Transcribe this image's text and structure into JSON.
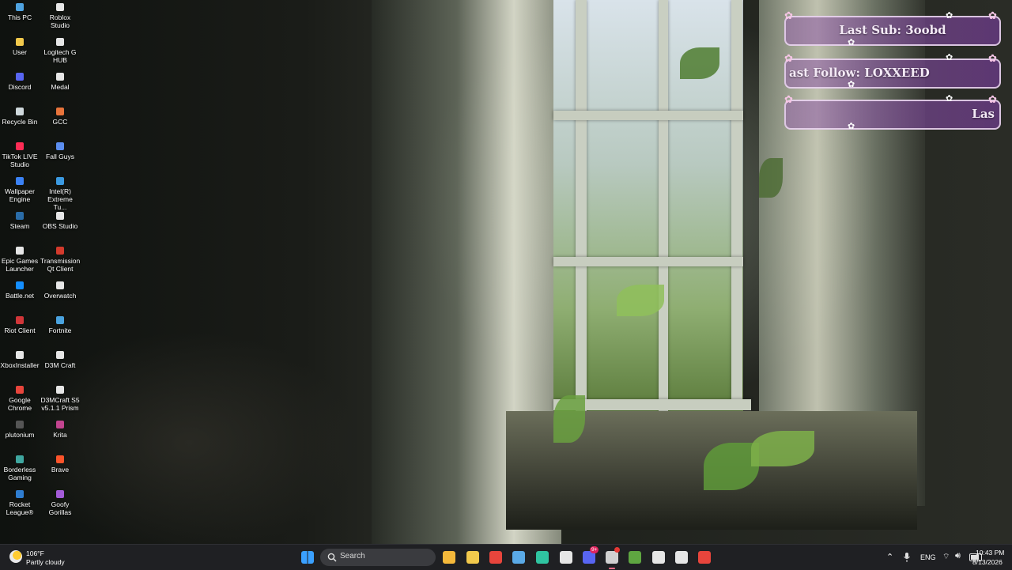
{
  "desktop": {
    "icons": [
      {
        "label": "This PC",
        "icon": "this-pc-icon",
        "color": "#4fa3e0"
      },
      {
        "label": "Roblox Studio",
        "icon": "roblox-studio-icon",
        "color": "#e6e6e6"
      },
      {
        "label": "User",
        "icon": "user-folder-icon",
        "color": "#f2c94c"
      },
      {
        "label": "Logitech G HUB",
        "icon": "logitech-g-hub-icon",
        "color": "#e6e6e6"
      },
      {
        "label": "Discord",
        "icon": "discord-icon",
        "color": "#5865f2"
      },
      {
        "label": "Medal",
        "icon": "medal-icon",
        "color": "#e6e6e6"
      },
      {
        "label": "Recycle Bin",
        "icon": "recycle-bin-icon",
        "color": "#cfd8dc"
      },
      {
        "label": "GCC",
        "icon": "gcc-icon",
        "color": "#e8743b"
      },
      {
        "label": "TikTok LIVE Studio",
        "icon": "tiktok-live-studio-icon",
        "color": "#fe2c55"
      },
      {
        "label": "Fall Guys",
        "icon": "fall-guys-icon",
        "color": "#5b8def"
      },
      {
        "label": "Wallpaper Engine",
        "icon": "wallpaper-engine-icon",
        "color": "#3b82f6"
      },
      {
        "label": "Intel(R) Extreme Tu...",
        "icon": "intel-xtu-icon",
        "color": "#3b9ae1"
      },
      {
        "label": "Steam",
        "icon": "steam-icon",
        "color": "#2a6ca8"
      },
      {
        "label": "OBS Studio",
        "icon": "obs-studio-icon",
        "color": "#e6e6e6"
      },
      {
        "label": "Epic Games Launcher",
        "icon": "epic-games-icon",
        "color": "#e6e6e6"
      },
      {
        "label": "Transmission Qt Client",
        "icon": "transmission-icon",
        "color": "#d33a2c"
      },
      {
        "label": "Battle.net",
        "icon": "battlenet-icon",
        "color": "#148eff"
      },
      {
        "label": "Overwatch",
        "icon": "overwatch-icon",
        "color": "#e6e6e6"
      },
      {
        "label": "Riot Client",
        "icon": "riot-client-icon",
        "color": "#d13639"
      },
      {
        "label": "Fortnite",
        "icon": "fortnite-icon",
        "color": "#4aa3df"
      },
      {
        "label": "XboxInstaller",
        "icon": "xbox-installer-icon",
        "color": "#e6e6e6"
      },
      {
        "label": "D3M Craft",
        "icon": "d3m-craft-icon",
        "color": "#e6e6e6"
      },
      {
        "label": "Google Chrome",
        "icon": "google-chrome-icon",
        "color": "#e8453c"
      },
      {
        "label": "D3MCraft S5 v5.1.1 Prism",
        "icon": "d3mcraft-prism-icon",
        "color": "#e6e6e6"
      },
      {
        "label": "plutonium",
        "icon": "plutonium-icon",
        "color": "#555555"
      },
      {
        "label": "Krita",
        "icon": "krita-icon",
        "color": "#c2448f"
      },
      {
        "label": "Borderless Gaming",
        "icon": "borderless-gaming-icon",
        "color": "#3fa7a0"
      },
      {
        "label": "Brave",
        "icon": "brave-icon",
        "color": "#fb542b"
      },
      {
        "label": "Rocket League®",
        "icon": "rocket-league-icon",
        "color": "#2f7dd1"
      },
      {
        "label": "Goofy Gorillas",
        "icon": "goofy-gorillas-icon",
        "color": "#a35bd8"
      }
    ]
  },
  "overlay": {
    "last_sub": "Last Sub: 3oobd",
    "last_follow": "ast Follow: LOXXEED",
    "third_widget": "Las",
    "colors": {
      "panel": "#8a5aa8",
      "border": "#f0dcf5",
      "flower": "#f7c6e6"
    }
  },
  "taskbar": {
    "weather": {
      "temp": "106°F",
      "condition": "Partly cloudy",
      "icon": "weather-sun-cloud-icon"
    },
    "search_placeholder": "Search",
    "apps": [
      {
        "name": "start-button",
        "icon": "windows-start-icon",
        "color": "#3aa0ff"
      },
      {
        "name": "taskbar-microsoft-store",
        "icon": "store-icon",
        "color": "#f5b93b"
      },
      {
        "name": "taskbar-file-explorer",
        "icon": "folder-icon",
        "color": "#f2c94c"
      },
      {
        "name": "taskbar-chrome",
        "icon": "chrome-icon",
        "color": "#e8453c"
      },
      {
        "name": "taskbar-app-blue",
        "icon": "app-window-icon",
        "color": "#5aa9e6"
      },
      {
        "name": "taskbar-edge",
        "icon": "edge-icon",
        "color": "#2fc4a1"
      },
      {
        "name": "taskbar-obs",
        "icon": "obs-icon",
        "color": "#e6e6e6"
      },
      {
        "name": "taskbar-discord",
        "icon": "discord-icon",
        "color": "#5865f2"
      },
      {
        "name": "taskbar-app-active",
        "icon": "recording-app-icon",
        "color": "#d0d0d0"
      },
      {
        "name": "taskbar-minecraft",
        "icon": "minecraft-icon",
        "color": "#5fa641"
      },
      {
        "name": "taskbar-roblox",
        "icon": "roblox-icon",
        "color": "#e6e6e6"
      },
      {
        "name": "taskbar-epic",
        "icon": "epic-icon",
        "color": "#e6e6e6"
      },
      {
        "name": "taskbar-chrome-2",
        "icon": "chrome-icon",
        "color": "#e8453c"
      }
    ],
    "discord_badge": "9+",
    "tray": {
      "language": "ENG",
      "time": "10:43 PM",
      "date": "8/13/2026"
    }
  }
}
